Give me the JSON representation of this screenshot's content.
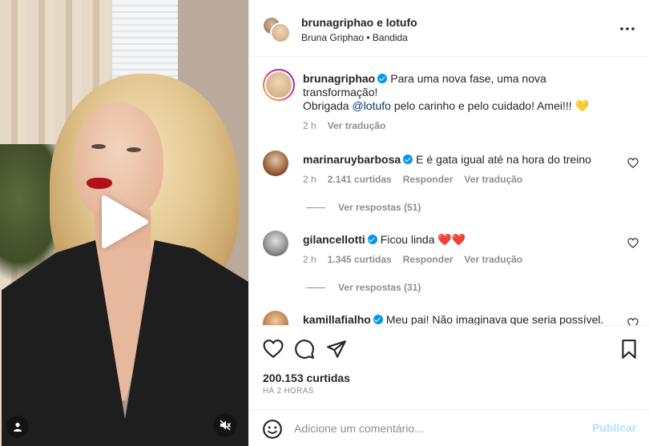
{
  "media": {
    "play_icon": "play-icon",
    "user_tag_icon": "user-icon",
    "mute_icon": "speaker-muted-icon"
  },
  "header": {
    "title": "brunagriphao e lotufo",
    "subtitle": "Bruna Griphao • Bandida",
    "more_icon": "more-options-icon"
  },
  "caption": {
    "username": "brunagriphao",
    "text_1": "Para uma nova fase, uma nova transformação!",
    "text_2_prefix": "Obrigada ",
    "mention": "@lotufo",
    "text_2_suffix": " pelo carinho e pelo cuidado! Amei!!! 💛",
    "time": "2 h",
    "translate": "Ver tradução"
  },
  "comments": [
    {
      "username": "marinaruybarbosa",
      "text": "E é gata igual até na hora do treino",
      "time": "2 h",
      "likes": "2.141 curtidas",
      "reply": "Responder",
      "translate": "Ver tradução",
      "view_replies": "Ver respostas (51)"
    },
    {
      "username": "gilancellotti",
      "text": "Ficou linda ❤️❤️",
      "time": "2 h",
      "likes": "1.345 curtidas",
      "reply": "Responder",
      "translate": "Ver tradução",
      "view_replies": "Ver respostas (31)"
    },
    {
      "username": "kamillafialho",
      "text": "Meu pai! Não imaginava que seria possível."
    }
  ],
  "actions": {
    "like_icon": "heart-icon",
    "comment_icon": "comment-icon",
    "share_icon": "send-icon",
    "save_icon": "bookmark-icon",
    "likes": "200.153 curtidas",
    "time_ago": "HÁ 2 HORAS"
  },
  "add_comment": {
    "placeholder": "Adicione um comentário...",
    "post_label": "Publicar",
    "emoji_icon": "emoji-icon"
  },
  "colors": {
    "text": "#262626",
    "secondary": "#8e8e8e",
    "verified": "#0095f6",
    "mention": "#00376b",
    "post_disabled": "#b2dffc"
  }
}
